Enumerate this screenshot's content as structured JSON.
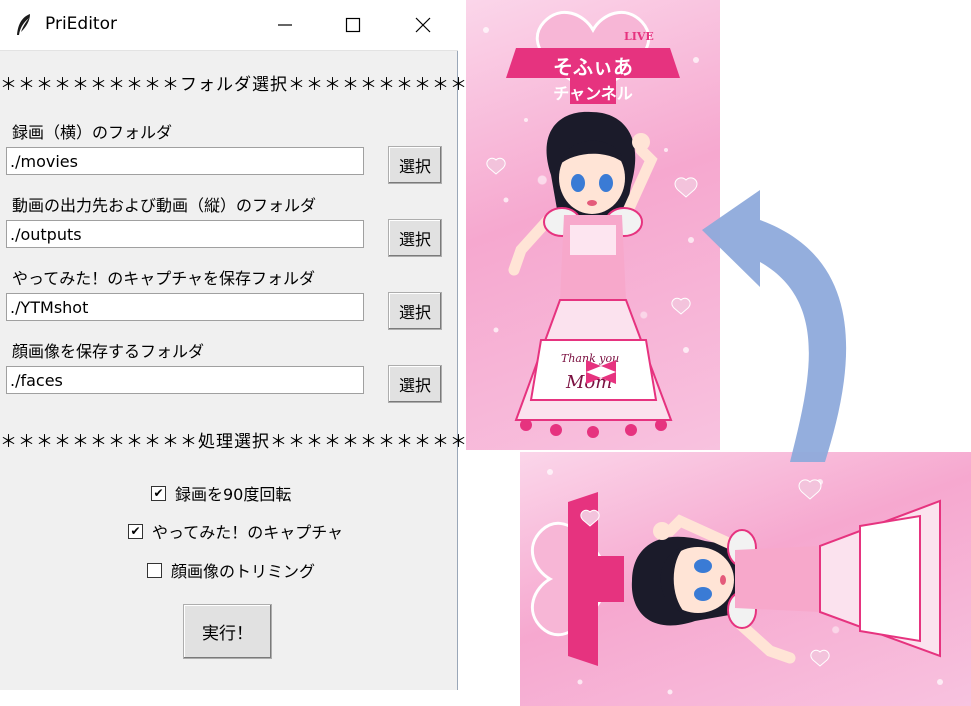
{
  "window": {
    "title": "PriEditor",
    "controls": {
      "minimize": "—",
      "maximize": "☐",
      "close": "✕"
    }
  },
  "sections": {
    "folder_header": "＊＊＊＊＊＊＊＊＊＊フォルダ選択＊＊＊＊＊＊＊＊＊＊",
    "process_header": "＊＊＊＊＊＊＊＊＊＊＊処理選択＊＊＊＊＊＊＊＊＊＊＊"
  },
  "folders": [
    {
      "label": "録画（横）のフォルダ",
      "value": "./movies",
      "button": "選択"
    },
    {
      "label": "動画の出力先および動画（縦）のフォルダ",
      "value": "./outputs",
      "button": "選択"
    },
    {
      "label": "やってみた！のキャプチャを保存フォルダ",
      "value": "./YTMshot",
      "button": "選択"
    },
    {
      "label": "顔画像を保存するフォルダ",
      "value": "./faces",
      "button": "選択"
    }
  ],
  "options": [
    {
      "label": "録画を90度回転",
      "checked": true,
      "mark": "✔"
    },
    {
      "label": "やってみた！のキャプチャ",
      "checked": true,
      "mark": "✔"
    },
    {
      "label": "顔画像のトリミング",
      "checked": false,
      "mark": ""
    }
  ],
  "run_button": "実行！",
  "illustration": {
    "banner_top": "そふぃあ",
    "banner_bottom": "チャンネル",
    "badge": "LIVE",
    "apron_script_1": "Thank you",
    "apron_script_2": "Mom",
    "arrow_color": "#8eaadb",
    "accent_pink": "#e6337f"
  }
}
